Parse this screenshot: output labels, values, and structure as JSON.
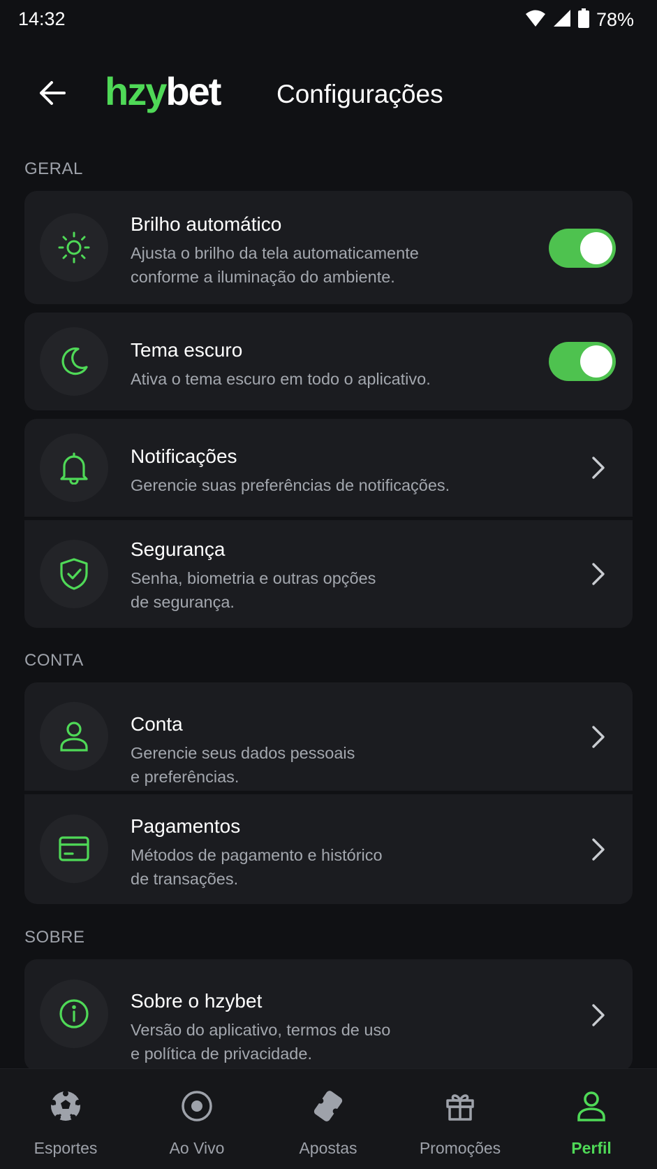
{
  "status_bar": {
    "time": "14:32",
    "battery": "78%"
  },
  "header": {
    "logo_part1": "hzy",
    "logo_part2": "bet",
    "title": "Configurações"
  },
  "sections": {
    "geral": "GERAL",
    "conta": "CONTA",
    "sobre": "SOBRE"
  },
  "items": {
    "brilho": {
      "title": "Brilho automático",
      "desc_line1": "Ajusta o brilho da tela automaticamente",
      "desc_line2": "conforme a iluminação do ambiente.",
      "enabled": true
    },
    "tema": {
      "title": "Tema escuro",
      "desc_line1": "Ativa o tema escuro em todo o aplicativo.",
      "enabled": true
    },
    "notificacoes": {
      "title": "Notificações",
      "desc_line1": "Gerencie suas preferências de notificações."
    },
    "seguranca": {
      "title": "Segurança",
      "desc_line1": "Senha, biometria e outras opções",
      "desc_line2": "de segurança."
    },
    "conta": {
      "title": "Conta",
      "desc_line1": "Gerencie seus dados pessoais",
      "desc_line2": "e preferências."
    },
    "pagamentos": {
      "title": "Pagamentos",
      "desc_line1": "Métodos de pagamento e histórico",
      "desc_line2": "de transações."
    },
    "sobre": {
      "title": "Sobre o hzybet",
      "desc_line1": "Versão do aplicativo, termos de uso",
      "desc_line2": "e política de privacidade."
    }
  },
  "bottom_nav": [
    {
      "label": "Esportes",
      "icon": "soccer-ball-icon",
      "active": false
    },
    {
      "label": "Ao Vivo",
      "icon": "live-icon",
      "active": false
    },
    {
      "label": "Apostas",
      "icon": "ticket-icon",
      "active": false
    },
    {
      "label": "Promoções",
      "icon": "gift-icon",
      "active": false
    },
    {
      "label": "Perfil",
      "icon": "user-icon",
      "active": true
    }
  ],
  "colors": {
    "accent": "#4fd957",
    "background": "#101114",
    "card": "#1b1c20",
    "toggle_on": "#4ec24f"
  }
}
